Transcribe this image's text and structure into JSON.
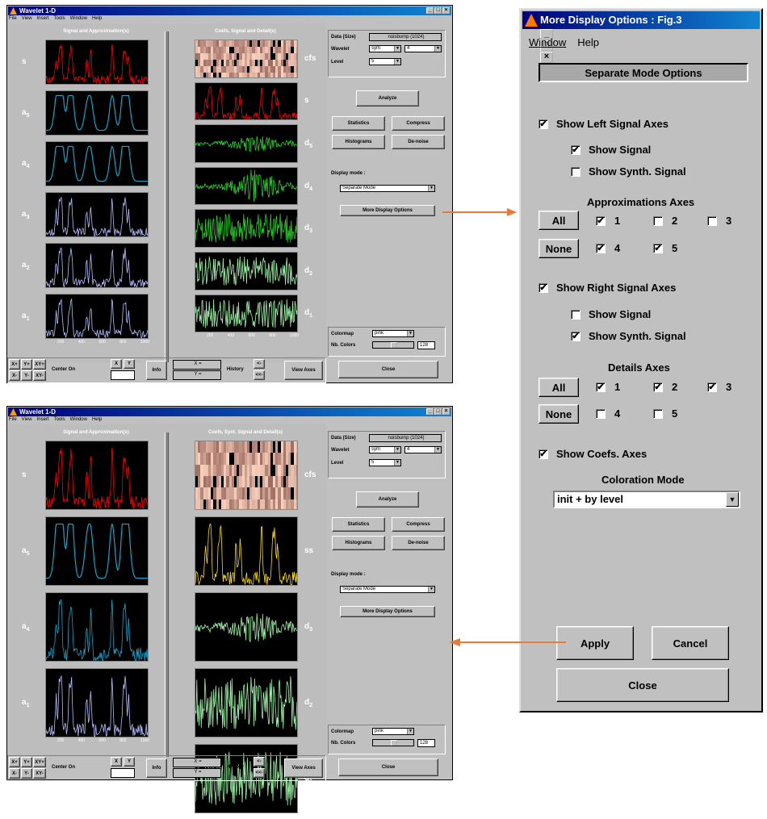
{
  "colors": {
    "accent_arrow": "#e87a3a",
    "title_blue": "#00007b",
    "signal_red": "#ff0000",
    "approx_teal": "#1aa3c8",
    "approx_lavender": "#b8c0ff",
    "detail_green": "#2ccf2c",
    "detail_mint": "#9ef5a8",
    "synth_yellow": "#ffe000"
  },
  "top_window": {
    "title": "Wavelet 1-D",
    "menu": [
      "File",
      "View",
      "Insert",
      "Tools",
      "Window",
      "Help"
    ],
    "left_header": "Signal and Approximation(s)",
    "right_header": "Coefs, Signal and Detail(s)",
    "left_rows": [
      {
        "base": "s",
        "sub": ""
      },
      {
        "base": "a",
        "sub": "5"
      },
      {
        "base": "a",
        "sub": "4"
      },
      {
        "base": "a",
        "sub": "3"
      },
      {
        "base": "a",
        "sub": "2"
      },
      {
        "base": "a",
        "sub": "1"
      }
    ],
    "right_rows": [
      {
        "base": "cfs",
        "sub": ""
      },
      {
        "base": "s",
        "sub": ""
      },
      {
        "base": "d",
        "sub": "5"
      },
      {
        "base": "d",
        "sub": "4"
      },
      {
        "base": "d",
        "sub": "3"
      },
      {
        "base": "d",
        "sub": "2"
      },
      {
        "base": "d",
        "sub": "1"
      }
    ],
    "x_ticks": [
      "200",
      "400",
      "600",
      "800",
      "1000"
    ],
    "data_label": "Data (Size)",
    "data_value": "noisbump (1024)",
    "wavelet_label": "Wavelet",
    "wavelet_family": "sym",
    "wavelet_order": "4",
    "level_label": "Level",
    "level_value": "5",
    "analyze": "Analyze",
    "statistics": "Statistics",
    "compress": "Compress",
    "histograms": "Histograms",
    "denoise": "De-noise",
    "display_mode_label": "Display mode :",
    "display_mode_value": "Separate Mode",
    "more_display": "More Display Options",
    "colormap_label": "Colormap",
    "colormap_value": "pink",
    "nbcolors_label": "Nb. Colors",
    "nbcolors_value": "128",
    "close": "Close",
    "bottom": {
      "xplus": "X+",
      "yplus": "Y+",
      "xyplus": "XY+",
      "xminus": "X-",
      "yminus": "Y-",
      "xyminus": "XY-",
      "center_on": "Center On",
      "x": "X",
      "y": "Y",
      "info": "Info",
      "x_eq": "X =",
      "y_eq": "Y =",
      "history": "History",
      "hist_fwd": "<-",
      "hist_back": "<<-",
      "view_axes": "View Axes"
    }
  },
  "bottom_window": {
    "title": "Wavelet 1-D",
    "menu": [
      "File",
      "View",
      "Insert",
      "Tools",
      "Window",
      "Help"
    ],
    "left_header": "Signal and Approximation(s)",
    "right_header": "Coefs, Synt. Signal and Detail(s)",
    "left_rows": [
      {
        "base": "s",
        "sub": ""
      },
      {
        "base": "a",
        "sub": "5"
      },
      {
        "base": "a",
        "sub": "4"
      },
      {
        "base": "a",
        "sub": "1"
      }
    ],
    "right_rows": [
      {
        "base": "cfs",
        "sub": ""
      },
      {
        "base": "ss",
        "sub": ""
      },
      {
        "base": "d",
        "sub": "3"
      },
      {
        "base": "d",
        "sub": "2"
      },
      {
        "base": "d",
        "sub": "1"
      }
    ]
  },
  "dialog": {
    "title": "More Display Options : Fig.3",
    "menu": [
      "Window",
      "Help"
    ],
    "header": "Separate Mode Options",
    "show_left": {
      "label": "Show Left Signal Axes",
      "checked": true
    },
    "show_signal_l": {
      "label": "Show Signal",
      "checked": true
    },
    "show_synth_l": {
      "label": "Show Synth. Signal",
      "checked": false
    },
    "approx_title": "Approximations Axes",
    "approx": [
      {
        "label": "1",
        "checked": true
      },
      {
        "label": "2",
        "checked": false
      },
      {
        "label": "3",
        "checked": false
      },
      {
        "label": "4",
        "checked": true
      },
      {
        "label": "5",
        "checked": true
      }
    ],
    "all": "All",
    "none": "None",
    "show_right": {
      "label": "Show Right Signal Axes",
      "checked": true
    },
    "show_signal_r": {
      "label": "Show Signal",
      "checked": false
    },
    "show_synth_r": {
      "label": "Show Synth. Signal",
      "checked": true
    },
    "details_title": "Details Axes",
    "details": [
      {
        "label": "1",
        "checked": true
      },
      {
        "label": "2",
        "checked": true
      },
      {
        "label": "3",
        "checked": true
      },
      {
        "label": "4",
        "checked": false
      },
      {
        "label": "5",
        "checked": false
      }
    ],
    "show_coefs": {
      "label": "Show Coefs. Axes",
      "checked": true
    },
    "coloration_title": "Coloration Mode",
    "coloration_value": "init + by level",
    "apply": "Apply",
    "cancel": "Cancel",
    "close": "Close"
  }
}
